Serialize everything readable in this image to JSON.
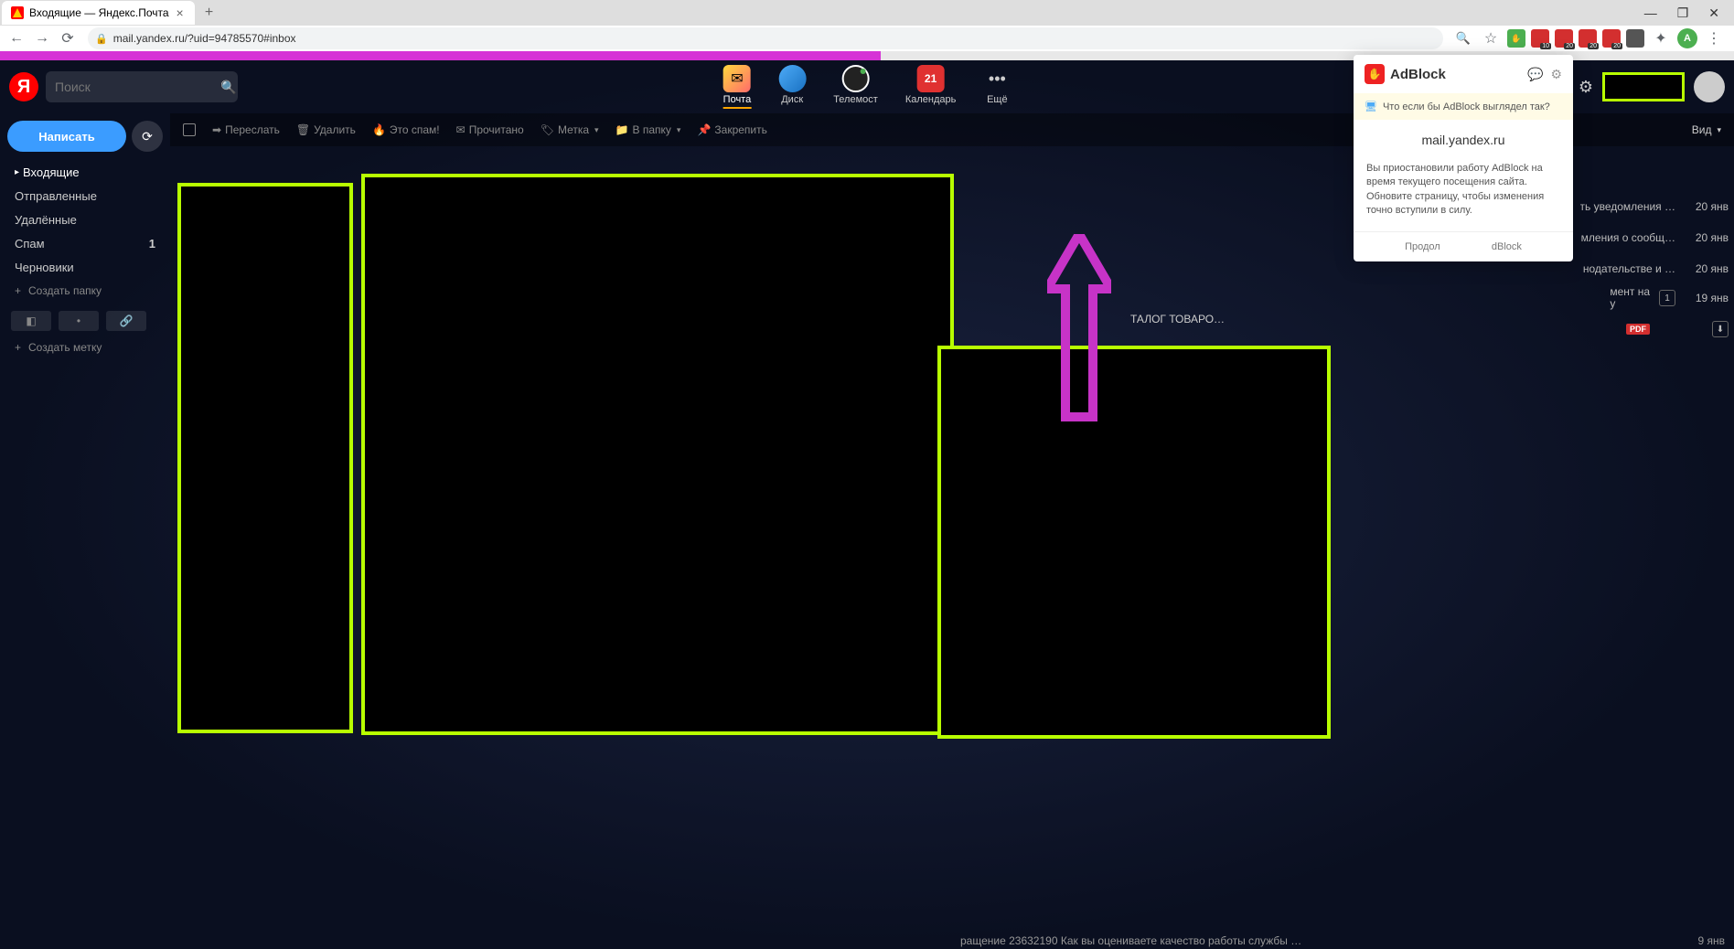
{
  "browser": {
    "tab_title": "Входящие — Яндекс.Почта",
    "url": "mail.yandex.ru/?uid=94785570#inbox",
    "profile_letter": "A",
    "ext_badges": [
      "10",
      "20",
      "20",
      "20"
    ]
  },
  "topbar": {
    "search_placeholder": "Поиск",
    "services": {
      "mail": "Почта",
      "disk": "Диск",
      "telemost": "Телемост",
      "calendar": "Календарь",
      "calendar_day": "21",
      "more": "Ещё"
    }
  },
  "sidebar": {
    "compose": "Написать",
    "folders": {
      "inbox": "Входящие",
      "sent": "Отправленные",
      "deleted": "Удалённые",
      "spam": "Спам",
      "spam_count": "1",
      "drafts": "Черновики"
    },
    "create_folder": "Создать папку",
    "create_label": "Создать метку"
  },
  "toolbar": {
    "forward": "Переслать",
    "delete": "Удалить",
    "spam": "Это спам!",
    "read": "Прочитано",
    "label": "Метка",
    "to_folder": "В папку",
    "pin": "Закрепить",
    "view": "Вид"
  },
  "messages": {
    "r1": {
      "subject": "ть уведомления …",
      "date": "20 янв"
    },
    "r2": {
      "subject": "мления о сообщ…",
      "date": "20 янв"
    },
    "r3": {
      "subject": "нодательстве и …",
      "date": "20 янв"
    },
    "r4": {
      "subject": "мент на\nу",
      "count": "1",
      "date": "19 янв"
    },
    "r5": {
      "pdf": "PDF"
    },
    "catalog": "ТАЛОГ ТОВАРО…",
    "bottom": "ращение 23632190 Как вы оцениваете качество работы службы …",
    "bottom_date": "9 янв"
  },
  "adblock": {
    "title": "AdBlock",
    "promo": "Что если бы AdBlock выглядел так?",
    "domain": "mail.yandex.ru",
    "body": "Вы приостановили работу AdBlock на время текущего посещения сайта. Обновите страницу, чтобы изменения точно вступили в силу.",
    "footer_left": "Продол",
    "footer_right": "dBlock"
  }
}
